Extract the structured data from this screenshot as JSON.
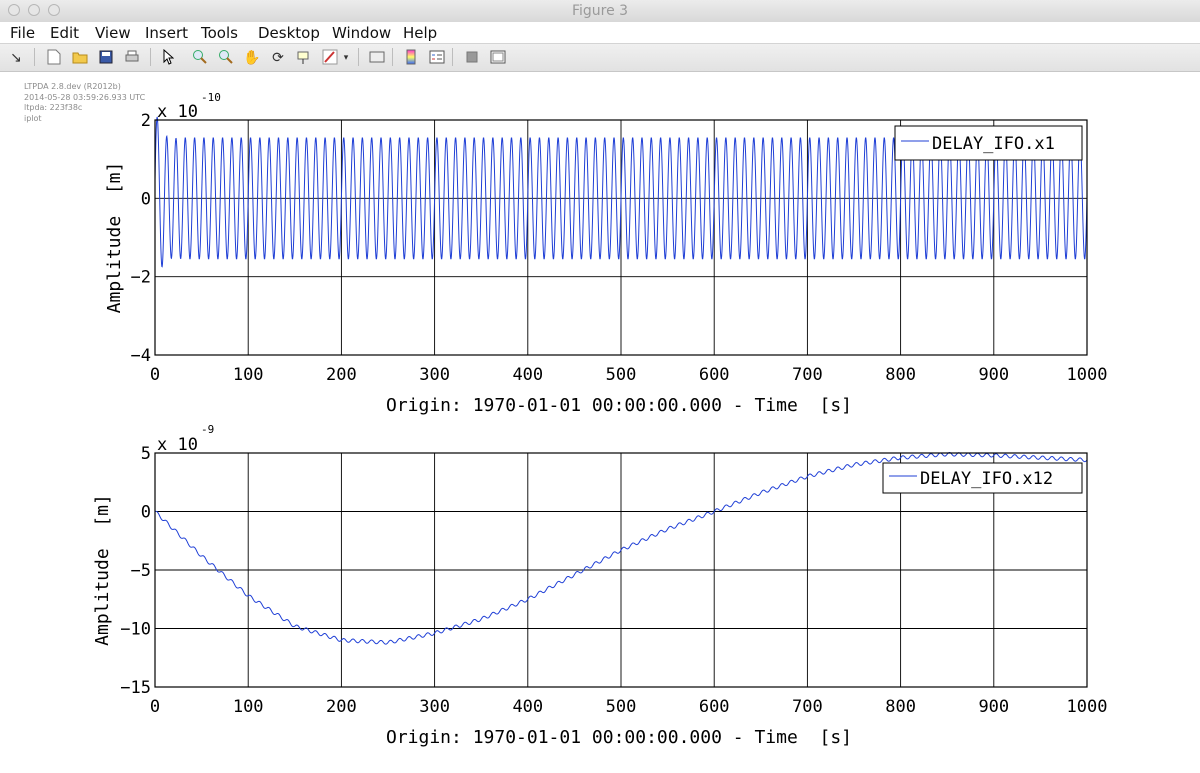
{
  "window": {
    "title": "Figure 3"
  },
  "menu": [
    "File",
    "Edit",
    "View",
    "Insert",
    "Tools",
    "Desktop",
    "Window",
    "Help"
  ],
  "toolbar": {
    "icons": [
      "arrow-icon",
      "new-figure-icon",
      "open-icon",
      "save-icon",
      "print-icon",
      "select-pointer-icon",
      "zoom-in-icon",
      "zoom-out-icon",
      "pan-hand-icon",
      "rotate-3d-icon",
      "data-cursor-icon",
      "brush-icon",
      "brush-dropdown-icon",
      "link-plot-icon",
      "colorbar-icon",
      "legend-icon",
      "hide-tools-icon",
      "show-tools-icon"
    ]
  },
  "meta": {
    "lines": [
      "LTPDA 2.8.dev (R2012b)",
      "2014-05-28 03:59:26.933 UTC",
      "ltpda: 223f38c",
      "iplot"
    ]
  },
  "colors": {
    "series": "#1f3fd6",
    "axes": "#000000",
    "background": "#ffffff"
  },
  "chart_data": [
    {
      "type": "line",
      "xlabel": "Origin: 1970-01-01 00:00:00.000 - Time  [s]",
      "ylabel": "Amplitude  [m]",
      "xlim": [
        0,
        1000
      ],
      "ylim": [
        -4,
        2
      ],
      "xticks": [
        0,
        100,
        200,
        300,
        400,
        500,
        600,
        700,
        800,
        900,
        1000
      ],
      "yticks": [
        -4,
        -2,
        0,
        2
      ],
      "exponent_base": "x 10",
      "exponent_power": "-10",
      "grid": true,
      "legend_position": "top-right",
      "series": [
        {
          "name": "DELAY_IFO.x1",
          "description": "oscillation ~0.1 Hz, amplitude ~1.55 after settling; initial peaks near 1.9 and -2.3",
          "x": [
            0,
            2,
            5,
            10,
            15,
            20,
            25,
            30,
            35,
            40,
            50,
            100,
            200,
            300,
            400,
            500,
            600,
            700,
            800,
            900,
            1000
          ],
          "y": [
            0,
            1.2,
            1.9,
            -2.3,
            1.3,
            -1.7,
            1.7,
            -1.6,
            1.6,
            -1.55,
            1.55,
            1.55,
            1.55,
            1.55,
            1.55,
            1.55,
            1.55,
            1.55,
            1.55,
            1.55,
            1.55
          ],
          "oscillation_period": 10,
          "steady_amplitude": 1.55
        }
      ]
    },
    {
      "type": "line",
      "xlabel": "Origin: 1970-01-01 00:00:00.000 - Time  [s]",
      "ylabel": "Amplitude  [m]",
      "xlim": [
        0,
        1000
      ],
      "ylim": [
        -15,
        5
      ],
      "xticks": [
        0,
        100,
        200,
        300,
        400,
        500,
        600,
        700,
        800,
        900,
        1000
      ],
      "yticks": [
        -15,
        -10,
        -5,
        0,
        5
      ],
      "exponent_base": "x 10",
      "exponent_power": "-9",
      "grid": true,
      "legend_position": "top-right",
      "series": [
        {
          "name": "DELAY_IFO.x12",
          "x": [
            0,
            50,
            100,
            150,
            200,
            250,
            300,
            350,
            400,
            450,
            500,
            550,
            600,
            650,
            700,
            750,
            800,
            850,
            900,
            950,
            1000
          ],
          "y": [
            0,
            -3.8,
            -7.2,
            -9.8,
            -11.0,
            -11.2,
            -10.4,
            -9.2,
            -7.5,
            -5.4,
            -3.3,
            -1.5,
            0,
            1.6,
            3.0,
            4.0,
            4.6,
            4.9,
            4.8,
            4.6,
            4.4
          ],
          "ripple_amplitude": 0.15,
          "ripple_period": 10
        }
      ]
    }
  ]
}
